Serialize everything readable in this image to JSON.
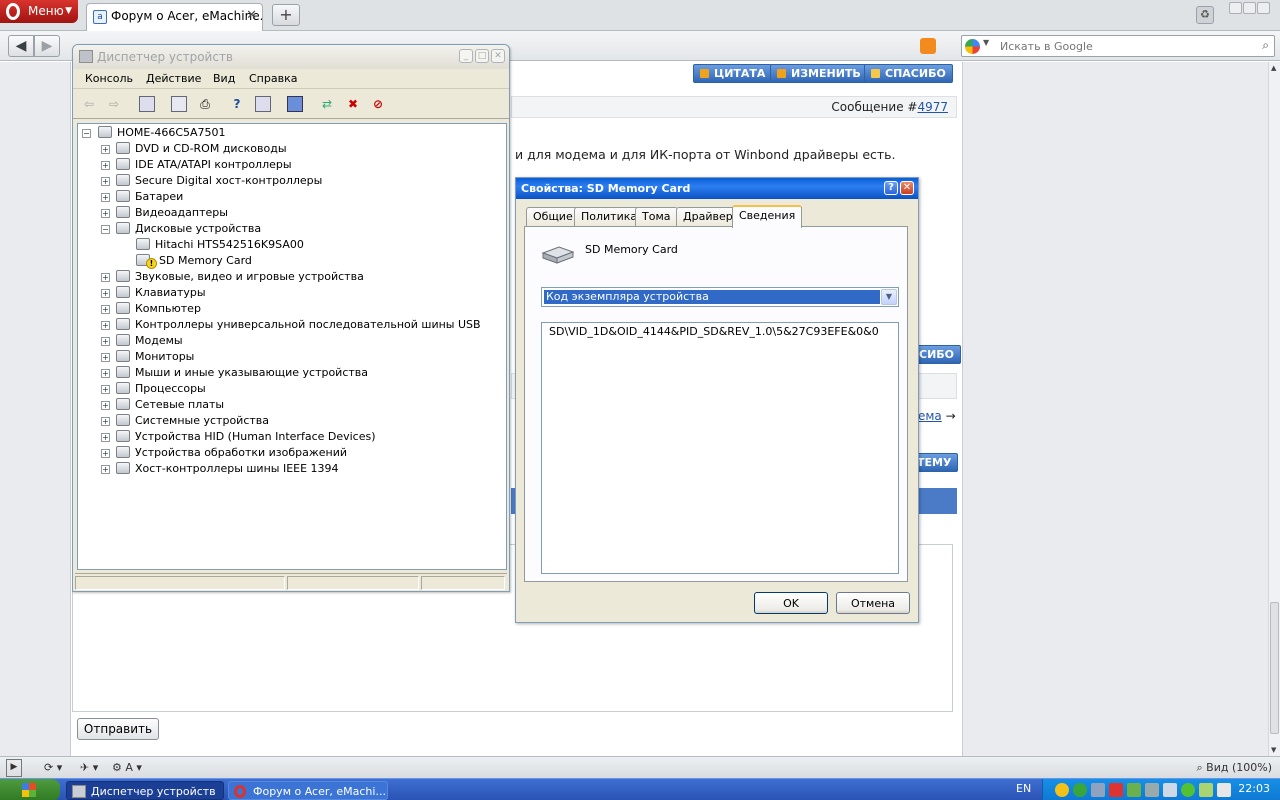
{
  "browser": {
    "menu_label": "Меню",
    "tab_title": "Форум о Acer, eMachine...",
    "search_placeholder": "Искать в Google",
    "zoom_label": "Вид (100%)"
  },
  "forum": {
    "buttons": {
      "quote": "ЦИТАТА",
      "edit": "ИЗМЕНИТЬ",
      "thanks": "СПАСИБО"
    },
    "message_label": "Сообщение #",
    "message_number": "4977",
    "post_text": "и для модема и для ИК-порта от Winbond драйверы есть.",
    "partial_thanks": "СИБО",
    "partial_link": "ема",
    "partial_arrow": "→",
    "partial_topic": "ТЕМУ",
    "send_button": "Отправить"
  },
  "device_manager": {
    "title": "Диспетчер устройств",
    "menu": [
      "Консоль",
      "Действие",
      "Вид",
      "Справка"
    ],
    "root": "HOME-466C5A7501",
    "nodes": [
      {
        "label": "DVD и CD-ROM дисководы",
        "expanded": false
      },
      {
        "label": "IDE ATA/ATAPI контроллеры",
        "expanded": false
      },
      {
        "label": "Secure Digital хост-контроллеры",
        "expanded": false
      },
      {
        "label": "Батареи",
        "expanded": false
      },
      {
        "label": "Видеоадаптеры",
        "expanded": false
      },
      {
        "label": "Дисковые устройства",
        "expanded": true
      },
      {
        "label": "Hitachi HTS542516K9SA00",
        "child": true
      },
      {
        "label": "SD Memory Card",
        "child": true,
        "warning": true
      },
      {
        "label": "Звуковые, видео и игровые устройства",
        "expanded": false
      },
      {
        "label": "Клавиатуры",
        "expanded": false
      },
      {
        "label": "Компьютер",
        "expanded": false
      },
      {
        "label": "Контроллеры универсальной последовательной шины USB",
        "expanded": false
      },
      {
        "label": "Модемы",
        "expanded": false
      },
      {
        "label": "Мониторы",
        "expanded": false
      },
      {
        "label": "Мыши и иные указывающие устройства",
        "expanded": false
      },
      {
        "label": "Процессоры",
        "expanded": false
      },
      {
        "label": "Сетевые платы",
        "expanded": false
      },
      {
        "label": "Системные устройства",
        "expanded": false
      },
      {
        "label": "Устройства HID (Human Interface Devices)",
        "expanded": false
      },
      {
        "label": "Устройства обработки изображений",
        "expanded": false
      },
      {
        "label": "Хост-контроллеры шины IEEE 1394",
        "expanded": false
      }
    ]
  },
  "properties": {
    "title": "Свойства: SD Memory Card",
    "tabs": [
      "Общие",
      "Политика",
      "Тома",
      "Драйвер",
      "Сведения"
    ],
    "active_tab": "Сведения",
    "device_name": "SD Memory Card",
    "property_selected": "Код экземпляра устройства",
    "property_value": "SD\\VID_1D&OID_4144&PID_SD&REV_1.0\\5&27C93EFE&0&0",
    "ok": "OK",
    "cancel": "Отмена"
  },
  "taskbar": {
    "items": [
      "Диспетчер устройств",
      "Форум о Acer, eMachi..."
    ],
    "language": "EN",
    "clock": "22:03"
  },
  "colors": {
    "xp_title_blue": "#0a5fd6",
    "forum_button_blue": "#2f66b5",
    "opera_red": "#c1231c",
    "taskbar_blue": "#2a53b5"
  }
}
